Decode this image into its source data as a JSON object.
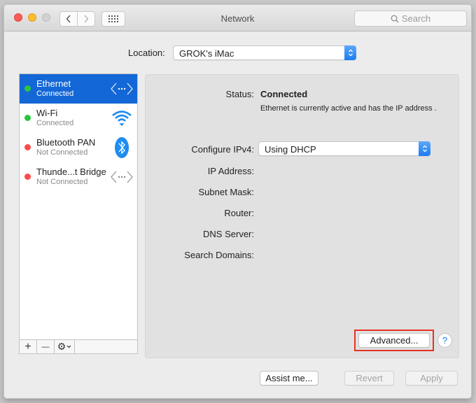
{
  "window": {
    "title": "Network",
    "search_placeholder": "Search"
  },
  "location": {
    "label": "Location:",
    "value": "GROK's iMac"
  },
  "services": [
    {
      "name": "Ethernet",
      "state": "Connected",
      "status_color": "#29c73f",
      "icon": "ethernet-icon",
      "selected": true
    },
    {
      "name": "Wi-Fi",
      "state": "Connected",
      "status_color": "#29c73f",
      "icon": "wifi-icon",
      "selected": false
    },
    {
      "name": "Bluetooth PAN",
      "state": "Not Connected",
      "status_color": "#fc4b4b",
      "icon": "bluetooth-icon",
      "selected": false
    },
    {
      "name": "Thunde...t Bridge",
      "state": "Not Connected",
      "status_color": "#fc4b4b",
      "icon": "thunderbolt-bridge-icon",
      "selected": false
    }
  ],
  "list_toolbar": {
    "add": "+",
    "remove": "—",
    "gear": "⚙"
  },
  "detail": {
    "status_label": "Status:",
    "status_value": "Connected",
    "status_description": "Ethernet is currently active and has the IP address                         .",
    "configure_label": "Configure IPv4:",
    "configure_value": "Using DHCP",
    "fields": [
      {
        "label": "IP Address:",
        "value": ""
      },
      {
        "label": "Subnet Mask:",
        "value": ""
      },
      {
        "label": "Router:",
        "value": ""
      },
      {
        "label": "DNS Server:",
        "value": ""
      },
      {
        "label": "Search Domains:",
        "value": ""
      }
    ],
    "advanced_label": "Advanced...",
    "help_label": "?"
  },
  "footer": {
    "assist_label": "Assist me...",
    "revert_label": "Revert",
    "apply_label": "Apply"
  },
  "colors": {
    "selection": "#1467d6",
    "accent": "#1a7cf2",
    "highlight_box": "#e53224"
  }
}
